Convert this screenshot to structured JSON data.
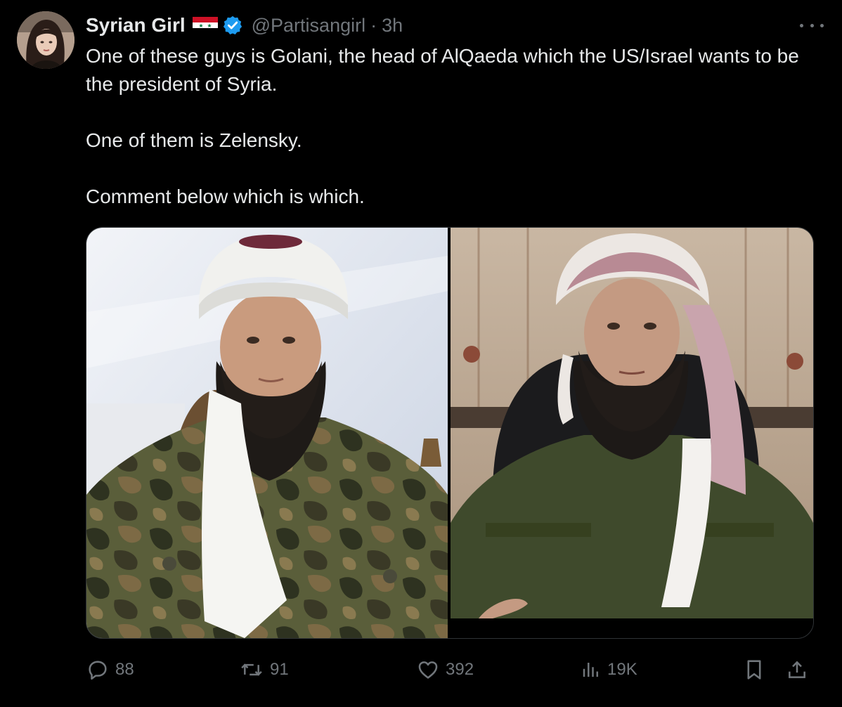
{
  "author": {
    "name": "Syrian Girl",
    "flag_icon": "syria-flag-icon",
    "verified_icon": "verified-badge-icon",
    "handle": "@Partisangirl",
    "separator": "·",
    "time": "3h"
  },
  "tweet": {
    "paragraphs": [
      "One of these guys is Golani, the head of AlQaeda which the US/Israel wants to be the president of Syria.",
      "One of them is Zelensky.",
      "Comment below which is which."
    ]
  },
  "actions": {
    "replies": "88",
    "reposts": "91",
    "likes": "392",
    "views": "19K"
  },
  "colors": {
    "background": "#000000",
    "text_primary": "#e7e9ea",
    "text_secondary": "#71767b",
    "verified_blue": "#1d9bf0",
    "border": "#2f3336"
  }
}
